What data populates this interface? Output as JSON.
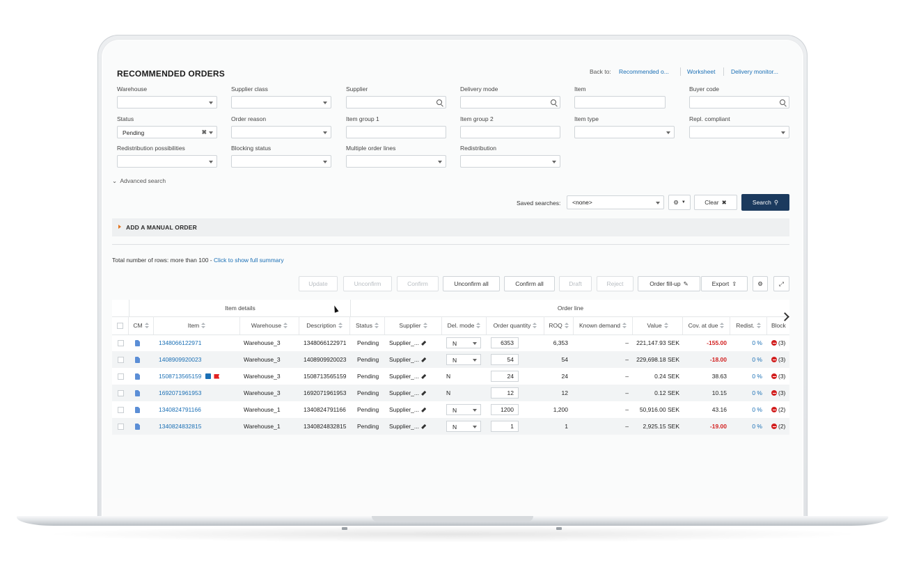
{
  "page": {
    "title": "RECOMMENDED ORDERS",
    "back_to_label": "Back to:",
    "back_links": [
      "Recommended o...",
      "Worksheet",
      "Delivery monitor..."
    ]
  },
  "filters": {
    "warehouse": {
      "label": "Warehouse",
      "value": ""
    },
    "supplier_class": {
      "label": "Supplier class",
      "value": ""
    },
    "supplier": {
      "label": "Supplier",
      "value": ""
    },
    "delivery_mode": {
      "label": "Delivery mode",
      "value": ""
    },
    "item": {
      "label": "Item",
      "value": ""
    },
    "buyer_code": {
      "label": "Buyer code",
      "value": ""
    },
    "status": {
      "label": "Status",
      "value": "Pending"
    },
    "order_reason": {
      "label": "Order reason",
      "value": ""
    },
    "item_group_1": {
      "label": "Item group 1",
      "value": ""
    },
    "item_group_2": {
      "label": "Item group 2",
      "value": ""
    },
    "item_type": {
      "label": "Item type",
      "value": ""
    },
    "repl_compliant": {
      "label": "Repl. compliant",
      "value": ""
    },
    "redistribution_possibilities": {
      "label": "Redistribution possibilities",
      "value": ""
    },
    "blocking_status": {
      "label": "Blocking status",
      "value": ""
    },
    "multiple_order_lines": {
      "label": "Multiple order lines",
      "value": ""
    },
    "redistribution": {
      "label": "Redistribution",
      "value": ""
    }
  },
  "advanced_search": "Advanced search",
  "search_bar": {
    "saved_label": "Saved searches:",
    "saved_value": "<none>",
    "clear_label": "Clear",
    "search_label": "Search"
  },
  "manual_order": "ADD A MANUAL ORDER",
  "summary": {
    "text": "Total number of rows: more than 100 - ",
    "link": "Click to show full summary"
  },
  "toolbar": {
    "update": "Update",
    "unconfirm": "Unconfirm",
    "confirm": "Confirm",
    "unconfirm_all": "Unconfirm all",
    "confirm_all": "Confirm all",
    "draft": "Draft",
    "reject": "Reject",
    "order_fillup": "Order fill-up",
    "export": "Export"
  },
  "table": {
    "groups": {
      "item_details": "Item details",
      "order_line": "Order line"
    },
    "columns": [
      "CM",
      "Item",
      "Warehouse",
      "Description",
      "Status",
      "Supplier",
      "Del. mode",
      "Order quantity",
      "ROQ",
      "Known demand",
      "Value",
      "Cov. at due",
      "Redist.",
      "Block"
    ],
    "rows": [
      {
        "item": "1348066122971",
        "warehouse": "Warehouse_3",
        "description": "1348066122971",
        "status": "Pending",
        "supplier": "Supplier_...",
        "del_mode": "N",
        "del_select": true,
        "order_qty": "6353",
        "roq": "6,353",
        "known_demand": "–",
        "value": "221,147.93 SEK",
        "cov": "-155.00",
        "cov_neg": true,
        "redist": "0 %",
        "block": "(3)",
        "icons": false
      },
      {
        "item": "1408909920023",
        "warehouse": "Warehouse_3",
        "description": "1408909920023",
        "status": "Pending",
        "supplier": "Supplier_...",
        "del_mode": "N",
        "del_select": true,
        "order_qty": "54",
        "roq": "54",
        "known_demand": "–",
        "value": "229,698.18 SEK",
        "cov": "-18.00",
        "cov_neg": true,
        "redist": "0 %",
        "block": "(3)",
        "icons": false
      },
      {
        "item": "1508713565159",
        "warehouse": "Warehouse_3",
        "description": "1508713565159",
        "status": "Pending",
        "supplier": "Supplier_...",
        "del_mode": "N",
        "del_select": false,
        "order_qty": "24",
        "roq": "24",
        "known_demand": "–",
        "value": "0.24 SEK",
        "cov": "38.63",
        "cov_neg": false,
        "redist": "0 %",
        "block": "(3)",
        "icons": true
      },
      {
        "item": "1692071961953",
        "warehouse": "Warehouse_3",
        "description": "1692071961953",
        "status": "Pending",
        "supplier": "Supplier_...",
        "del_mode": "N",
        "del_select": false,
        "order_qty": "12",
        "roq": "12",
        "known_demand": "–",
        "value": "0.12 SEK",
        "cov": "10.15",
        "cov_neg": false,
        "redist": "0 %",
        "block": "(3)",
        "icons": false
      },
      {
        "item": "1340824791166",
        "warehouse": "Warehouse_1",
        "description": "1340824791166",
        "status": "Pending",
        "supplier": "Supplier_...",
        "del_mode": "N",
        "del_select": true,
        "order_qty": "1200",
        "roq": "1,200",
        "known_demand": "–",
        "value": "50,916.00 SEK",
        "cov": "43.16",
        "cov_neg": false,
        "redist": "0 %",
        "block": "(2)",
        "icons": false
      },
      {
        "item": "1340824832815",
        "warehouse": "Warehouse_1",
        "description": "1340824832815",
        "status": "Pending",
        "supplier": "Supplier_...",
        "del_mode": "N",
        "del_select": true,
        "order_qty": "1",
        "roq": "1",
        "known_demand": "–",
        "value": "2,925.15 SEK",
        "cov": "-19.00",
        "cov_neg": true,
        "redist": "0 %",
        "block": "(2)",
        "icons": false
      }
    ]
  },
  "colors": {
    "accent": "#1a6fb5",
    "primary_button": "#1b3a5e",
    "negative": "#d21f1f",
    "caret": "#e2741d"
  }
}
